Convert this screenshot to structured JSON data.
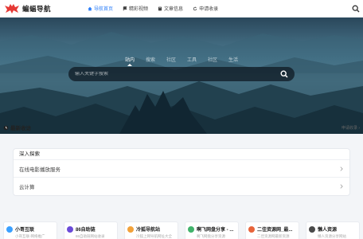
{
  "header": {
    "logo_text": "蝙蝠导航",
    "nav": [
      {
        "label": "导航首页",
        "icon": "home-icon"
      },
      {
        "label": "精彩视频",
        "icon": "flag-icon"
      },
      {
        "label": "文章信息",
        "icon": "book-icon"
      },
      {
        "label": "申请收录",
        "icon": "refresh-icon"
      }
    ],
    "active_nav": 0
  },
  "hero": {
    "tabs": [
      "站内",
      "搜索",
      "社区",
      "工具",
      "社区",
      "生活"
    ],
    "active_tab": 0,
    "search_placeholder": "输入关键字搜索"
  },
  "recent": {
    "title": "最新收访",
    "more_label": "申请收录 ›"
  },
  "panel": {
    "title": "深入探索",
    "rows": [
      "在线电影播放服务",
      "云计算"
    ]
  },
  "cards": [
    {
      "name": "小哥互联",
      "desc": "小哥互联-网络推广",
      "color": "#3aa0ff"
    },
    {
      "name": "86自助链",
      "desc": "86自助链网站收录",
      "color": "#6b4bd8"
    },
    {
      "name": "冷狐导航站",
      "desc": "冷狐上网导航网址大全",
      "color": "#f2a23a"
    },
    {
      "name": "啊飞网盘分享 - ...",
      "desc": "啊飞网盘分享资源",
      "color": "#41b36b"
    },
    {
      "name": "二佳资源网_最...",
      "desc": "二佳资源网最新资源",
      "color": "#e8643a"
    },
    {
      "name": "懒人资源",
      "desc": "懒人资源分享网站",
      "color": "#4a4a4a"
    }
  ],
  "colors": {
    "accent": "#2d7ff9",
    "logo_red": "#e53935"
  }
}
